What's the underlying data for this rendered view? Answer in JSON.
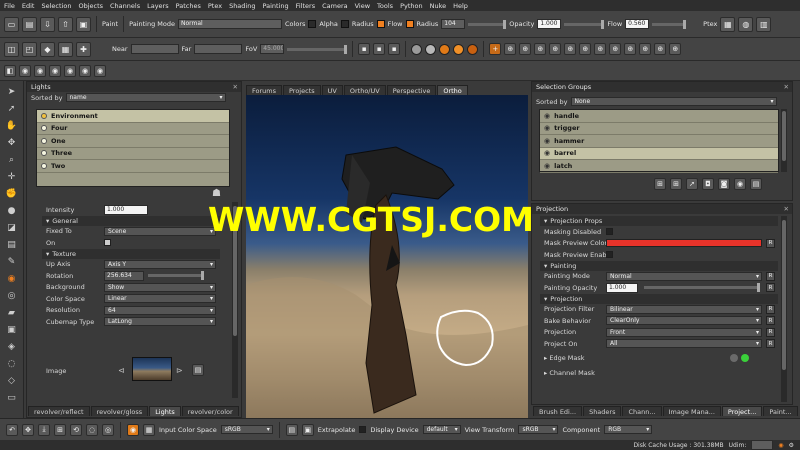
{
  "menu": [
    "File",
    "Edit",
    "Selection",
    "Objects",
    "Channels",
    "Layers",
    "Patches",
    "Ptex",
    "Shading",
    "Painting",
    "Filters",
    "Camera",
    "View",
    "Tools",
    "Python",
    "Nuke",
    "Help"
  ],
  "toolbar1": {
    "paint_label": "Paint",
    "painting_mode_label": "Painting Mode",
    "painting_mode_value": "Normal",
    "colors_label": "Colors",
    "alpha_label": "Alpha",
    "radius_label": "Radius",
    "flow_label": "Flow",
    "radius2_label": "Radius",
    "radius_value": "104",
    "opacity_label": "Opacity",
    "opacity_value": "1.000",
    "flow2_label": "Flow",
    "flow_value": "0.560",
    "ptex_label": "Ptex"
  },
  "toolbar2": {
    "near_label": "Near",
    "far_label": "Far",
    "fov_label": "FoV",
    "fov_value": "45.000"
  },
  "lights_panel": {
    "title": "Lights",
    "sorted_by_label": "Sorted by",
    "sorted_by_value": "name",
    "items": [
      "Environment",
      "Four",
      "One",
      "Three",
      "Two"
    ],
    "intensity_label": "Intensity",
    "intensity_value": "1.000",
    "section_general": "General",
    "fixed_to_label": "Fixed To",
    "fixed_to_value": "Scene",
    "on_label": "On",
    "section_texture": "Texture",
    "up_axis_label": "Up Axis",
    "up_axis_value": "Axis Y",
    "rotation_label": "Rotation",
    "rotation_value": "256.634",
    "background_label": "Background",
    "background_value": "Show",
    "color_space_label": "Color Space",
    "color_space_value": "Linear",
    "resolution_label": "Resolution",
    "resolution_value": "64",
    "cubemap_type_label": "Cubemap Type",
    "cubemap_type_value": "LatLong",
    "image_label": "Image",
    "tabs": [
      "revolver/reflect",
      "revolver/gloss",
      "Lights",
      "revolver/color"
    ]
  },
  "viewport_tabs": [
    "Forums",
    "Projects",
    "UV",
    "Ortho/UV",
    "Perspective",
    "Ortho"
  ],
  "selection_groups": {
    "title": "Selection Groups",
    "sorted_by_label": "Sorted by",
    "sorted_by_value": "None",
    "items": [
      "handle",
      "trigger",
      "hammer",
      "barrel",
      "latch"
    ]
  },
  "projection": {
    "title": "Projection",
    "section_props": "Projection Props",
    "masking_disabled_label": "Masking Disabled",
    "mask_preview_color_label": "Mask Preview Color",
    "mask_preview_enabled_label": "Mask Preview Enabled",
    "section_painting": "Painting",
    "painting_mode_label": "Painting Mode",
    "painting_mode_value": "Normal",
    "painting_opacity_label": "Painting Opacity",
    "painting_opacity_value": "1.000",
    "section_projection": "Projection",
    "projection_filter_label": "Projection Filter",
    "projection_filter_value": "Bilinear",
    "bake_behavior_label": "Bake Behavior",
    "bake_behavior_value": "ClearOnly",
    "projection_label": "Projection",
    "projection_value": "Front",
    "project_on_label": "Project On",
    "project_on_value": "All",
    "edge_mask_label": "Edge Mask",
    "channel_mask_label": "Channel Mask",
    "tabs": [
      "Brush Edi...",
      "Shaders",
      "Chann...",
      "Image Mana...",
      "Project...",
      "Paint..."
    ],
    "mask_color": "#e8332a"
  },
  "statusbar": {
    "input_color_space_label": "Input Color Space",
    "input_color_space_value": "sRGB",
    "extrapolate_label": "Extrapolate",
    "display_device_label": "Display Device",
    "display_device_value": "default",
    "view_transform_label": "View Transform",
    "view_transform_value": "sRGB",
    "component_label": "Component",
    "component_value": "RGB",
    "disk_cache_label": "Disk Cache Usage : 301.38MB",
    "udim_label": "Udim:"
  },
  "watermark": "WWW.CGTSJ.COM",
  "colors": {
    "accent": "#f08020",
    "list_bg": "#9c9b86",
    "list_sel": "#c4c2a5",
    "watermark": "#ffff00"
  }
}
